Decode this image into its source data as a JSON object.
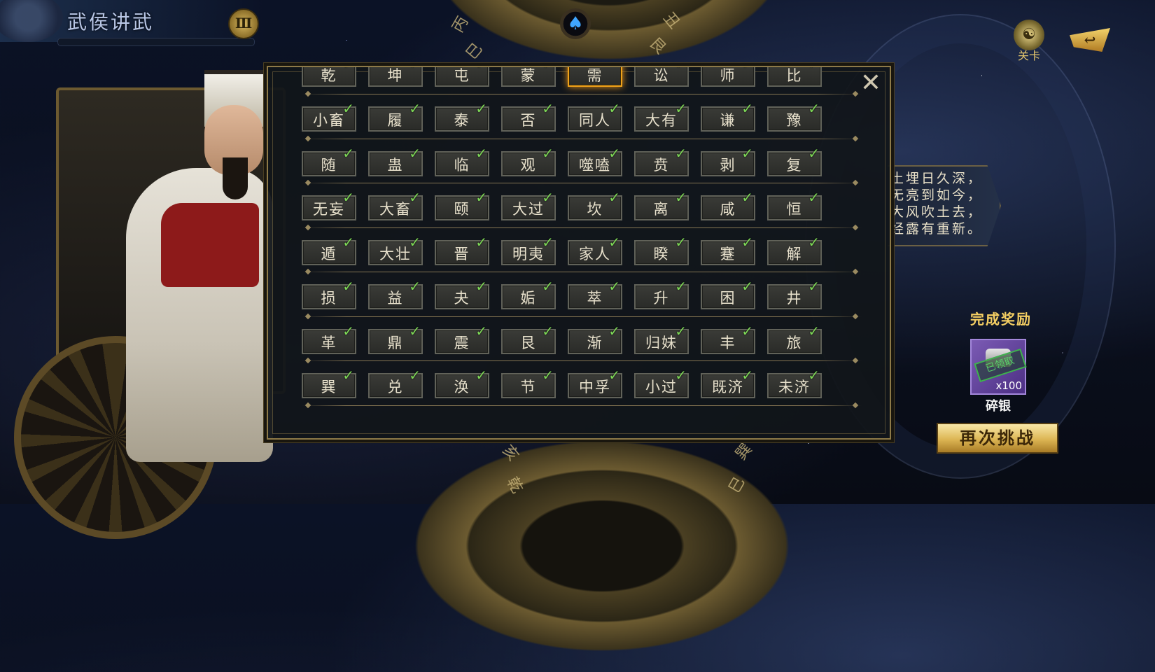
{
  "header": {
    "title": "武侯讲武",
    "book_icon": "book-icon"
  },
  "top_right": {
    "level_label": "关卡",
    "level_icon": "bagua-icon",
    "back_icon": "back-arrow-icon"
  },
  "background": {
    "top_wheel": {
      "marks": [
        "丙",
        "巳",
        "丑",
        "艮"
      ],
      "icon": "spade-icon"
    },
    "bottom_wheel": {
      "marks": [
        "亥",
        "乾",
        "巽",
        "巳"
      ]
    }
  },
  "grid": {
    "rows": [
      [
        {
          "name": "乾",
          "done": true
        },
        {
          "name": "坤",
          "done": true
        },
        {
          "name": "屯",
          "done": true
        },
        {
          "name": "蒙",
          "done": true
        },
        {
          "name": "需",
          "done": false,
          "selected": true
        },
        {
          "name": "讼",
          "done": true
        },
        {
          "name": "师",
          "done": true
        },
        {
          "name": "比",
          "done": true
        }
      ],
      [
        {
          "name": "小畜",
          "done": true
        },
        {
          "name": "履",
          "done": true
        },
        {
          "name": "泰",
          "done": true
        },
        {
          "name": "否",
          "done": true
        },
        {
          "name": "同人",
          "done": true
        },
        {
          "name": "大有",
          "done": true
        },
        {
          "name": "谦",
          "done": true
        },
        {
          "name": "豫",
          "done": true
        }
      ],
      [
        {
          "name": "随",
          "done": true
        },
        {
          "name": "蛊",
          "done": true
        },
        {
          "name": "临",
          "done": true
        },
        {
          "name": "观",
          "done": true
        },
        {
          "name": "噬嗑",
          "done": true
        },
        {
          "name": "贲",
          "done": true
        },
        {
          "name": "剥",
          "done": true
        },
        {
          "name": "复",
          "done": true
        }
      ],
      [
        {
          "name": "无妄",
          "done": true
        },
        {
          "name": "大畜",
          "done": true
        },
        {
          "name": "颐",
          "done": true
        },
        {
          "name": "大过",
          "done": true
        },
        {
          "name": "坎",
          "done": true
        },
        {
          "name": "离",
          "done": true
        },
        {
          "name": "咸",
          "done": true
        },
        {
          "name": "恒",
          "done": true
        }
      ],
      [
        {
          "name": "遁",
          "done": true
        },
        {
          "name": "大壮",
          "done": true
        },
        {
          "name": "晋",
          "done": true
        },
        {
          "name": "明夷",
          "done": true
        },
        {
          "name": "家人",
          "done": true
        },
        {
          "name": "睽",
          "done": true
        },
        {
          "name": "蹇",
          "done": true
        },
        {
          "name": "解",
          "done": true
        }
      ],
      [
        {
          "name": "损",
          "done": true
        },
        {
          "name": "益",
          "done": true
        },
        {
          "name": "夬",
          "done": true
        },
        {
          "name": "姤",
          "done": true
        },
        {
          "name": "萃",
          "done": true
        },
        {
          "name": "升",
          "done": true
        },
        {
          "name": "困",
          "done": true
        },
        {
          "name": "井",
          "done": true
        }
      ],
      [
        {
          "name": "革",
          "done": true
        },
        {
          "name": "鼎",
          "done": true
        },
        {
          "name": "震",
          "done": true
        },
        {
          "name": "艮",
          "done": true
        },
        {
          "name": "渐",
          "done": true
        },
        {
          "name": "归妹",
          "done": true
        },
        {
          "name": "丰",
          "done": true
        },
        {
          "name": "旅",
          "done": true
        }
      ],
      [
        {
          "name": "巽",
          "done": true
        },
        {
          "name": "兑",
          "done": true
        },
        {
          "name": "涣",
          "done": true
        },
        {
          "name": "节",
          "done": true
        },
        {
          "name": "中孚",
          "done": true
        },
        {
          "name": "小过",
          "done": true
        },
        {
          "name": "既济",
          "done": true
        },
        {
          "name": "未济",
          "done": true
        }
      ]
    ],
    "close_icon": "close-icon",
    "check_icon": "check-icon"
  },
  "poem": {
    "lines": [
      "土埋日久深，",
      "无亮到如今，",
      "大风吹土去，",
      "经露有重新。"
    ]
  },
  "reward": {
    "title": "完成奖励",
    "item_name": "碎银",
    "quantity": "x100",
    "stamp": "已领取",
    "item_icon": "silver-ingot-icon"
  },
  "actions": {
    "retry_label": "再次挑战"
  },
  "colors": {
    "check": "#7ed957",
    "selected_border": "#f0a21a",
    "gold": "#f5cf63",
    "reward_purple": "#7b5bb4"
  }
}
